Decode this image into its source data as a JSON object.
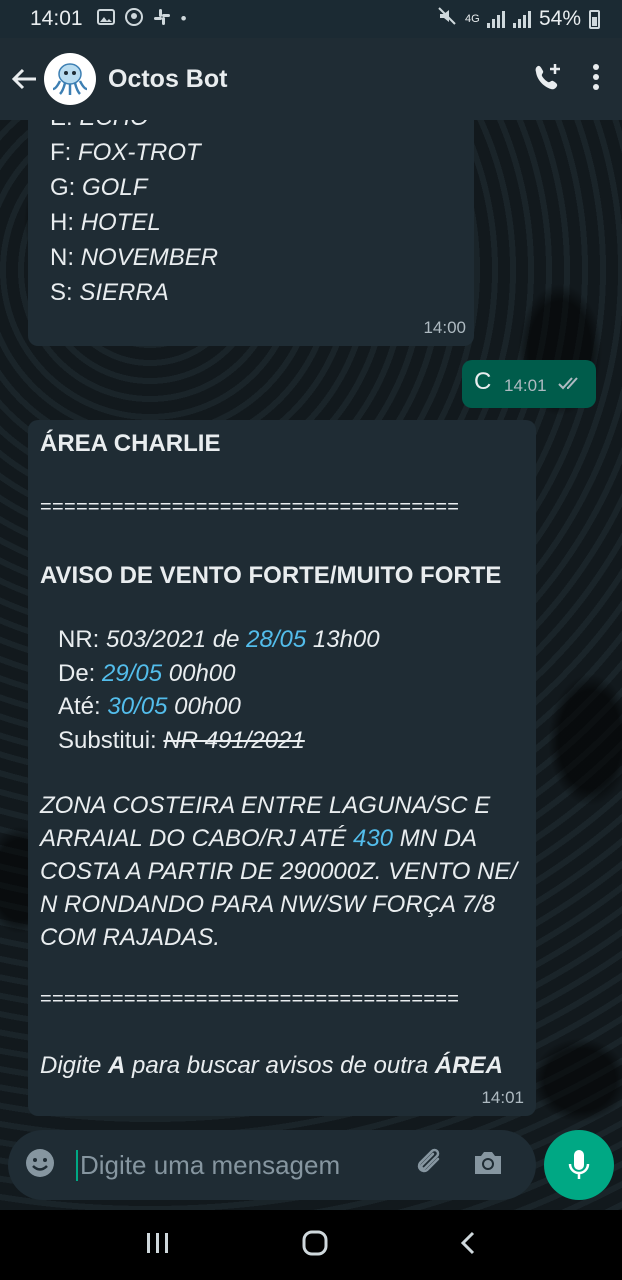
{
  "status": {
    "time": "14:01",
    "battery": "54%",
    "network": "4G"
  },
  "header": {
    "title": "Octos Bot"
  },
  "message1": {
    "lines": [
      {
        "letter": "E",
        "word": "ECHO"
      },
      {
        "letter": "F",
        "word": "FOX-TROT"
      },
      {
        "letter": "G",
        "word": "GOLF"
      },
      {
        "letter": "H",
        "word": "HOTEL"
      },
      {
        "letter": "N",
        "word": "NOVEMBER"
      },
      {
        "letter": "S",
        "word": "SIERRA"
      }
    ],
    "sep": ":",
    "time": "14:00"
  },
  "message2": {
    "text": "C",
    "time": "14:01"
  },
  "message3": {
    "area": "ÁREA CHARLIE",
    "divider": "===================================",
    "heading": "AVISO DE VENTO FORTE/MUITO FORTE",
    "nr_label": "NR:",
    "nr_value": "503/2021 de",
    "nr_date": "28/05",
    "nr_time": "13h00",
    "de_label": "De:",
    "de_date": "29/05",
    "de_time": "00h00",
    "ate_label": "Até:",
    "ate_date": "30/05",
    "ate_time": "00h00",
    "subst_label": "Substitui:",
    "subst_value": "NR 491/2021",
    "body_l1": "ZONA COSTEIRA ENTRE LAGUNA/SC E",
    "body_l2a": "ARRAIAL DO CABO/RJ ATÉ",
    "body_l2b": "430",
    "body_l2c": "MN DA",
    "body_l3": "COSTA A PARTIR DE 290000Z. VENTO NE/",
    "body_l4": "N RONDANDO PARA NW/SW FORÇA 7/8",
    "body_l5": "COM RAJADAS.",
    "footer_a": "Digite",
    "footer_b": "A",
    "footer_c": "para buscar avisos de outra",
    "footer_d": "ÁREA",
    "time": "14:01"
  },
  "composer": {
    "placeholder": "Digite uma mensagem"
  },
  "colors": {
    "accent": "#00a884",
    "link": "#53bdeb",
    "bubble_in": "#1f2c34",
    "bubble_out": "#005c4b"
  }
}
